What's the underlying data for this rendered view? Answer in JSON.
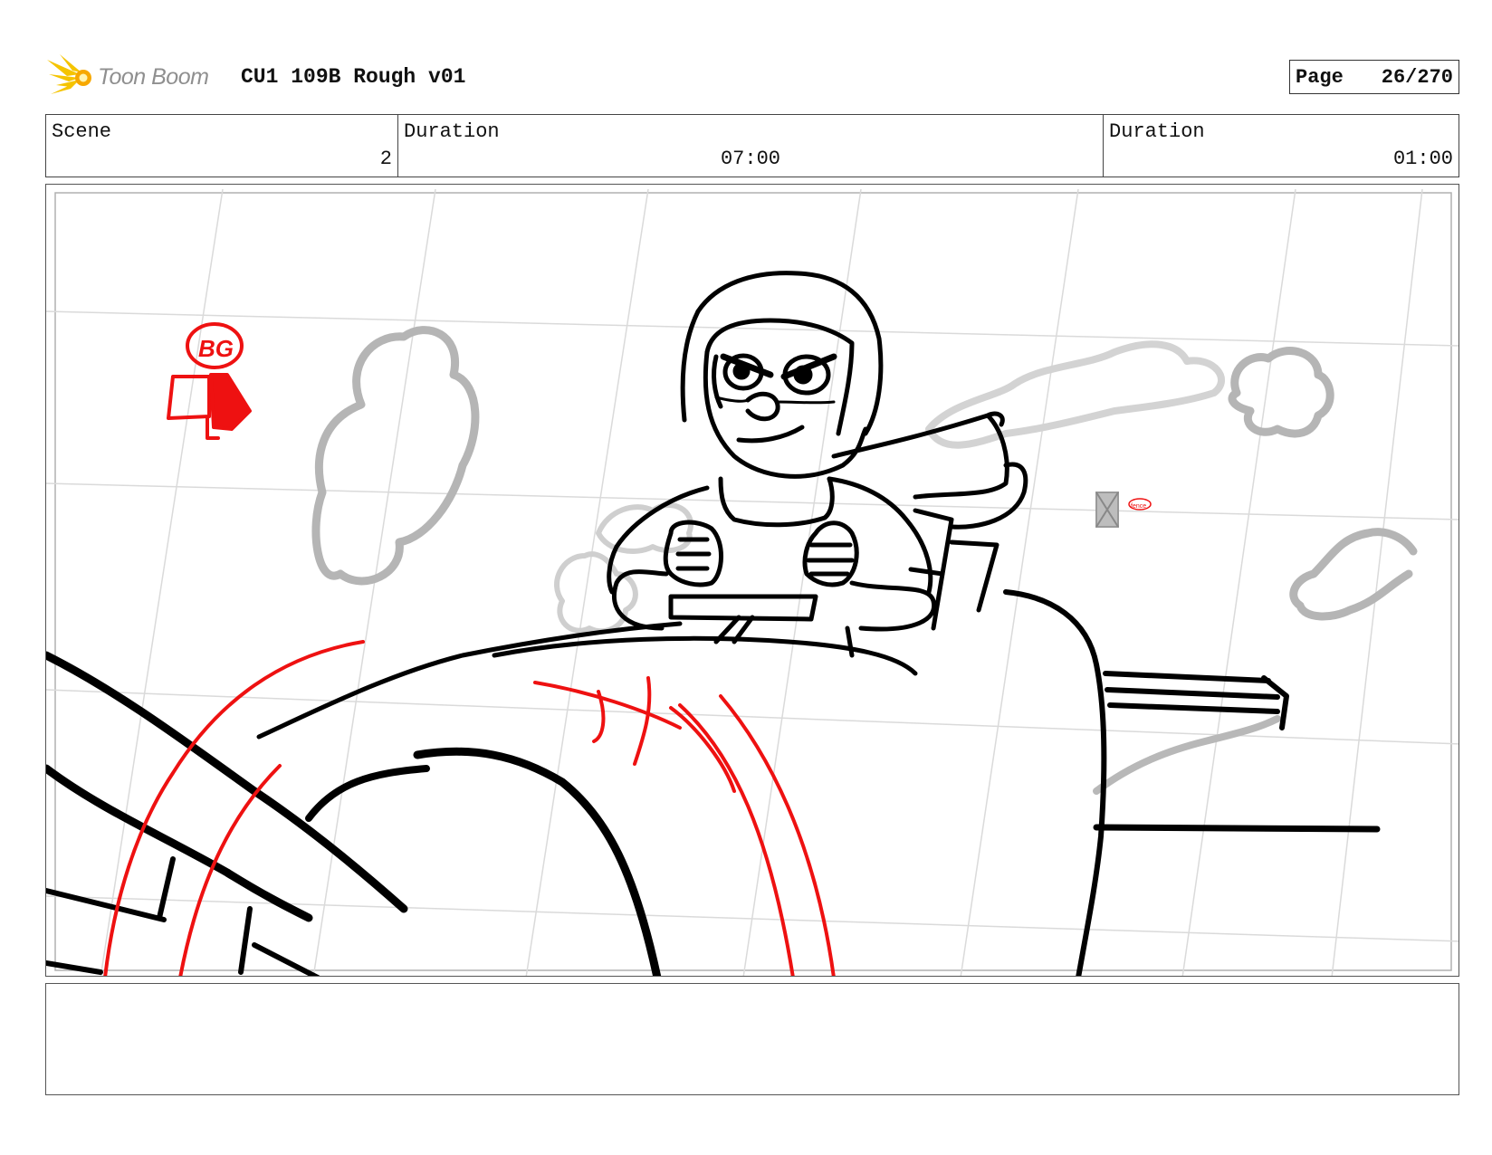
{
  "header": {
    "logo_text": "Toon Boom",
    "title": "CU1 109B Rough v01",
    "page_label": "Page",
    "page_number": "26/270"
  },
  "info": {
    "scene_label": "Scene",
    "scene_value": "2",
    "duration1_label": "Duration",
    "duration1_value": "07:00",
    "duration2_label": "Duration",
    "duration2_value": "01:00"
  },
  "panel": {
    "icon": "storyboard-drawing",
    "annotation_bg": "BG",
    "annotation_small": "fence",
    "colors": {
      "line": "#000000",
      "cloud": "#b3b3b3",
      "grid": "#d9d9d9",
      "markup": "#ee1111"
    }
  },
  "notes": {
    "text": ""
  }
}
